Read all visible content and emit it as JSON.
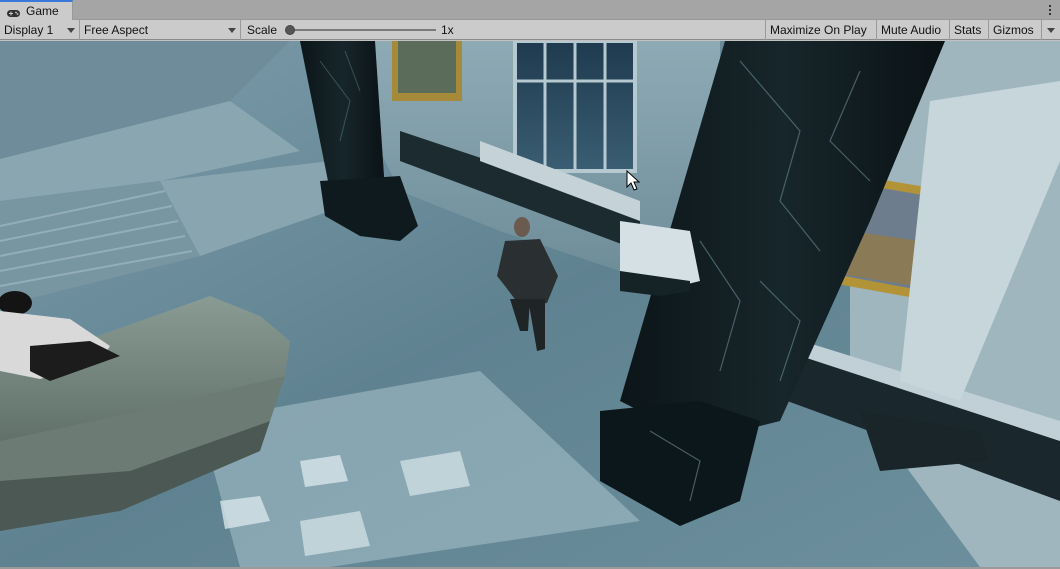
{
  "tab": {
    "label": "Game",
    "icon": "gamepad-icon"
  },
  "window_menu_icon": "kebab-menu-icon",
  "toolbar": {
    "display": "Display 1",
    "aspect": "Free Aspect",
    "scale_label": "Scale",
    "scale_value": "1x",
    "maximize": "Maximize On Play",
    "mute": "Mute Audio",
    "stats": "Stats",
    "gizmos": "Gizmos"
  },
  "colors": {
    "tab_accent": "#3a79d8",
    "toolbar_bg": "#cbcbcb",
    "tabstrip_bg": "#a5a5a5"
  }
}
